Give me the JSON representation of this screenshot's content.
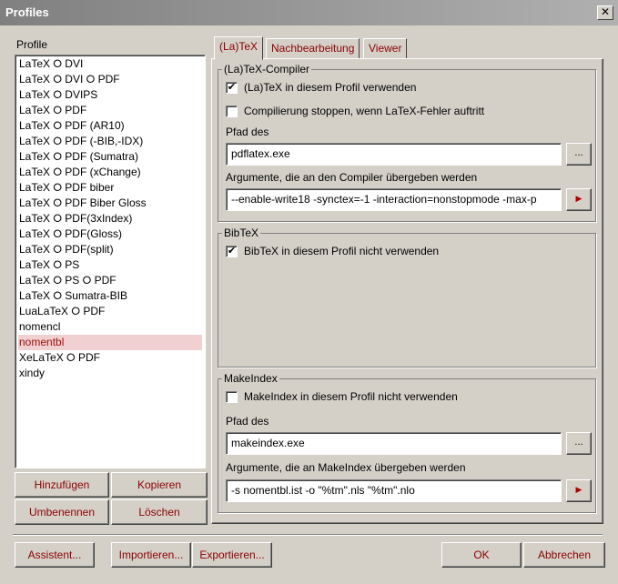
{
  "window": {
    "title": "Profiles",
    "close_glyph": "✕"
  },
  "profile_label": "Profile",
  "profiles": [
    "LaTeX ⭘ DVI",
    "LaTeX ⭘ DVI ⭘ PDF",
    "LaTeX ⭘ DVIPS",
    "LaTeX ⭘ PDF",
    "LaTeX ⭘ PDF (AR10)",
    "LaTeX ⭘ PDF (-BIB,-IDX)",
    "LaTeX ⭘ PDF (Sumatra)",
    "LaTeX ⭘ PDF (xChange)",
    "LaTeX ⭘ PDF biber",
    "LaTeX ⭘ PDF Biber Gloss",
    "LaTeX ⭘ PDF(3xIndex)",
    "LaTeX ⭘ PDF(Gloss)",
    "LaTeX ⭘ PDF(split)",
    "LaTeX ⭘ PS",
    "LaTeX ⭘ PS ⭘ PDF",
    "LaTeX ⭘ Sumatra-BIB",
    "LuaLaTeX ⭘ PDF",
    "nomencl",
    "nomentbl",
    "XeLaTeX ⭘ PDF",
    "xindy"
  ],
  "selected_profile": "nomentbl",
  "profile_buttons": {
    "add": "Hinzufügen",
    "copy": "Kopieren",
    "rename": "Umbenennen",
    "delete": "Löschen"
  },
  "tabs": [
    {
      "label": "(La)TeX",
      "active": true
    },
    {
      "label": "Nachbearbeitung",
      "active": false
    },
    {
      "label": "Viewer",
      "active": false
    }
  ],
  "latex_group": {
    "legend": "(La)TeX-Compiler",
    "use_checkbox": {
      "label": "(La)TeX in diesem Profil verwenden",
      "checked": true
    },
    "stop_checkbox": {
      "label": "Compilierung stoppen, wenn LaTeX-Fehler auftritt",
      "checked": false
    },
    "path_label": "Pfad des",
    "path_value": "pdflatex.exe",
    "args_label": "Argumente, die an den Compiler übergeben werden",
    "args_value": "--enable-write18 -synctex=-1 -interaction=nonstopmode -max-p"
  },
  "bibtex_group": {
    "legend": "BibTeX",
    "notuse_checkbox": {
      "label": "BibTeX in diesem Profil nicht verwenden",
      "checked": true
    }
  },
  "makeindex_group": {
    "legend": "MakeIndex",
    "notuse_checkbox": {
      "label": "MakeIndex in diesem Profil nicht verwenden",
      "checked": false
    },
    "path_label": "Pfad des",
    "path_value": "makeindex.exe",
    "args_label": "Argumente, die an MakeIndex übergeben werden",
    "args_value": "-s nomentbl.ist -o \"%tm\".nls \"%tm\".nlo"
  },
  "browse_label": "...",
  "arrow_glyph": "▶",
  "check_glyph": "✔",
  "bottom_buttons": {
    "assistant": "Assistent...",
    "import": "Importieren...",
    "export": "Exportieren...",
    "ok": "OK",
    "cancel": "Abbrechen"
  },
  "colors": {
    "accent_text": "#8b0000",
    "selected_bg": "#f0d0d0",
    "face": "#d4d0c8"
  }
}
